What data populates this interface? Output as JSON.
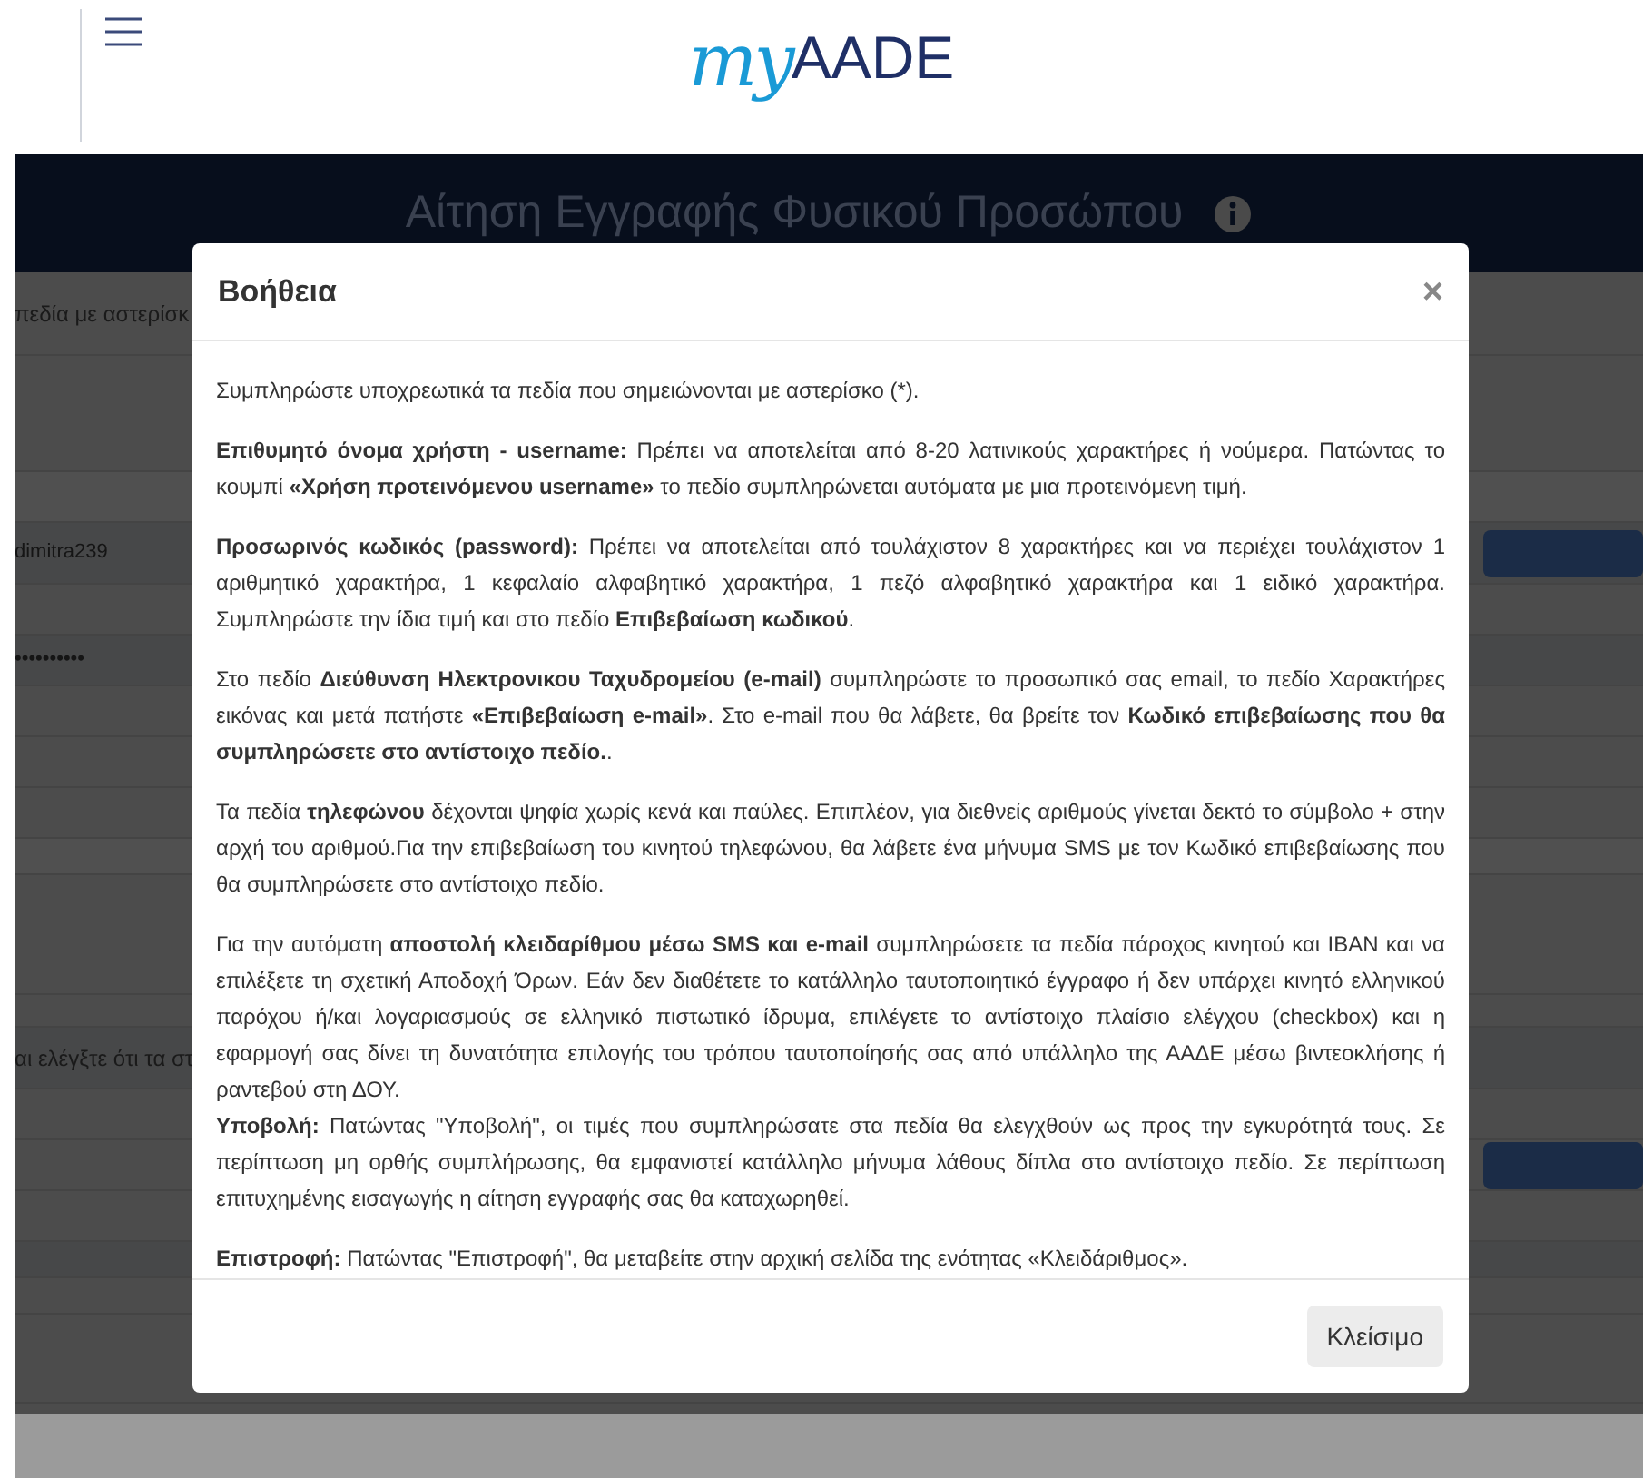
{
  "header": {
    "logo_script": "my",
    "logo_text": "AADE"
  },
  "background": {
    "title": "Αίτηση Εγγραφής Φυσικού Προσώπου",
    "texts": [
      {
        "kind": "note",
        "text": "πεδία με αστερίσκ"
      },
      {
        "kind": "field",
        "text": "dimitra239"
      },
      {
        "kind": "field",
        "text": "••••••••••"
      },
      {
        "kind": "note",
        "text": "αι ελέγξτε ότι τα στ"
      }
    ]
  },
  "modal": {
    "title": "Βοήθεια",
    "close": "×",
    "paragraphs": [
      {
        "kind": "para",
        "text": "Συμπληρώστε υποχρεωτικά τα πεδία που σημειώνονται με αστερίσκο (*)."
      },
      {
        "kind": "para",
        "text": "**Επιθυμητό όνομα χρήστη - username:** Πρέπει να αποτελείται από 8-20 λατινικούς χαρακτήρες ή νούμερα. Πατώντας το κουμπί **«Χρήση προτεινόμενου username»** το πεδίο συμπληρώνεται αυτόματα με μια προτεινόμενη τιμή."
      },
      {
        "kind": "para",
        "text": "**Προσωρινός κωδικός (password):** Πρέπει να αποτελείται από τουλάχιστον 8 χαρακτήρες και να περιέχει τουλάχιστον 1 αριθμητικό χαρακτήρα, 1 κεφαλαίο αλφαβητικό χαρακτήρα, 1 πεζό αλφαβητικό χαρακτήρα και 1 ειδικό χαρακτήρα. Συμπληρώστε την ίδια τιμή και στο πεδίο **Επιβεβαίωση κωδικού**."
      },
      {
        "kind": "para",
        "text": "Στο πεδίο **Διεύθυνση Ηλεκτρονικου Ταχυδρομείου (e-mail)** συμπληρώστε το προσωπικό σας email, το πεδίο Χαρακτήρες εικόνας και μετά πατήστε **«Επιβεβαίωση e-mail»**. Στο e-mail που θα λάβετε, θα βρείτε τον **Κωδικό επιβεβαίωσης που θα συμπληρώσετε στο αντίστοιχο πεδίο.**."
      },
      {
        "kind": "para",
        "text": "Τα πεδία **τηλεφώνου** δέχονται ψηφία χωρίς κενά και παύλες. Επιπλέον, για διεθνείς αριθμούς γίνεται δεκτό το σύμβολο + στην αρχή του αριθμού.Για την επιβεβαίωση του κινητού τηλεφώνου, θα λάβετε ένα μήνυμα SMS με τον Κωδικό επιβεβαίωσης που θα συμπληρώσετε στο αντίστοιχο πεδίο."
      },
      {
        "kind": "para",
        "text": "Για την αυτόματη **αποστολή κλειδαρίθμου μέσω SMS και e-mail** συμπληρώσετε τα πεδία πάροχος κινητού και IBAN και να επιλέξετε τη σχετική Αποδοχή Όρων. Εάν δεν διαθέτετε το κατάλληλο ταυτοποιητικό έγγραφο ή δεν υπάρχει κινητό ελληνικού παρόχου ή/και λογαριασμούς σε ελληνικό πιστωτικό ίδρυμα, επιλέγετε το αντίστοιχο πλαίσιο ελέγχου (checkbox) και η εφαρμογή σας δίνει τη δυνατότητα επιλογής του τρόπου ταυτοποίησής σας από υπάλληλο της ΑΑΔΕ μέσω βιντεοκλήσης ή ραντεβού στη ΔΟΥ."
      },
      {
        "kind": "continuation",
        "text": "**Υποβολή:** Πατώντας \"Υποβολή\", οι τιμές που συμπληρώσατε στα πεδία θα ελεγχθούν ως προς την εγκυρότητά τους. Σε περίπτωση μη ορθής συμπλήρωσης, θα εμφανιστεί κατάλληλο μήνυμα λάθους δίπλα στο αντίστοιχο πεδίο. Σε περίπτωση επιτυχημένης εισαγωγής η αίτηση εγγραφής σας θα καταχωρηθεί."
      },
      {
        "kind": "para",
        "text": "**Επιστροφή:** Πατώντας \"Επιστροφή\", θα μεταβείτε στην αρχική σελίδα της ενότητας «Κλειδάριθμος»."
      }
    ],
    "close_button": "Κλείσιμο"
  }
}
